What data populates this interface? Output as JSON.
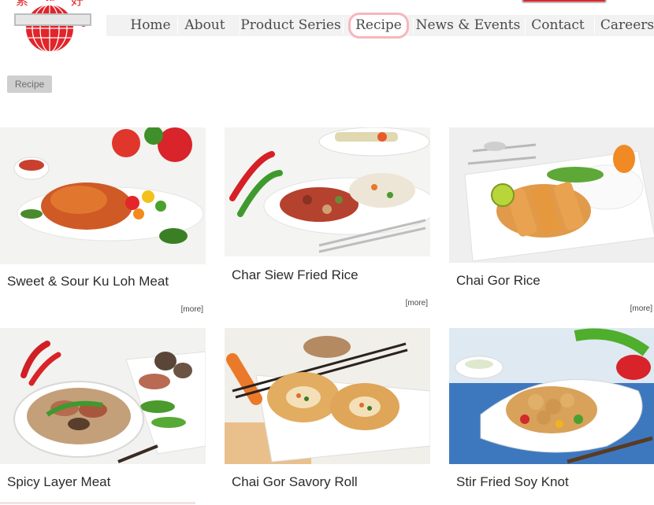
{
  "header": {
    "logo_alt": "Company logo",
    "logo_chars": "素 雅 好"
  },
  "nav": {
    "items": [
      {
        "label": "Home"
      },
      {
        "label": "About"
      },
      {
        "label": "Product Series"
      },
      {
        "label": "Recipe",
        "active": true
      },
      {
        "label": "News & Events"
      },
      {
        "label": "Contact"
      },
      {
        "label": "Careers"
      }
    ]
  },
  "breadcrumb": {
    "label": "Recipe"
  },
  "recipes": [
    {
      "title": "Sweet & Sour Ku Loh Meat",
      "more": "[more]",
      "image": "sweet-sour-ku-loh-meat-photo"
    },
    {
      "title": "Char Siew Fried Rice",
      "more": "[more]",
      "image": "char-siew-fried-rice-photo"
    },
    {
      "title": "Chai Gor Rice",
      "more": "[more]",
      "image": "chai-gor-rice-photo"
    },
    {
      "title": "Spicy Layer Meat",
      "more": "",
      "image": "spicy-layer-meat-photo"
    },
    {
      "title": "Chai Gor Savory Roll",
      "more": "",
      "image": "chai-gor-savory-roll-photo"
    },
    {
      "title": "Stir Fried Soy Knot",
      "more": "",
      "image": "stir-fried-soy-knot-photo"
    }
  ],
  "colors": {
    "brand_red": "#e0252b",
    "nav_bg": "#f2f2f2",
    "active_ring": "#f6b6bd"
  }
}
